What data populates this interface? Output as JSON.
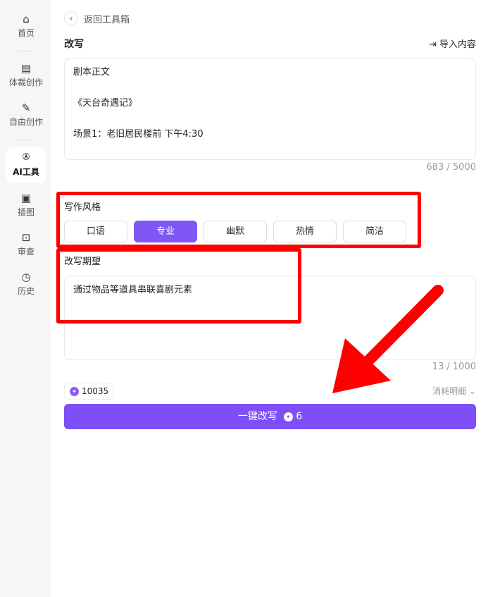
{
  "sidebar": {
    "items": [
      {
        "label": "首页",
        "icon": "home-icon"
      },
      {
        "label": "体裁创作",
        "icon": "scroll-icon"
      },
      {
        "label": "自由创作",
        "icon": "quill-icon"
      },
      {
        "label": "AI工具",
        "icon": "ai-icon"
      },
      {
        "label": "插图",
        "icon": "image-icon"
      },
      {
        "label": "审查",
        "icon": "review-icon"
      },
      {
        "label": "历史",
        "icon": "history-icon"
      }
    ]
  },
  "header": {
    "back_label": "返回工具箱",
    "title": "改写",
    "import_label": "导入内容"
  },
  "source": {
    "text": "剧本正文\n\n《天台奇遇记》\n\n场景1：老旧居民楼前 下午4:30",
    "count": "683 / 5000"
  },
  "style": {
    "label": "写作风格",
    "options": [
      "口语",
      "专业",
      "幽默",
      "热情",
      "简洁"
    ],
    "selected": "专业"
  },
  "expect": {
    "label": "改写期望",
    "text": "通过物品等道具串联喜剧元素",
    "count": "13 / 1000"
  },
  "credits": {
    "balance": "10035",
    "detail_label": "消耗明细"
  },
  "action": {
    "label": "一键改写",
    "cost": "6"
  },
  "colors": {
    "accent": "#7e4ff7",
    "annotation": "#ff0000"
  }
}
